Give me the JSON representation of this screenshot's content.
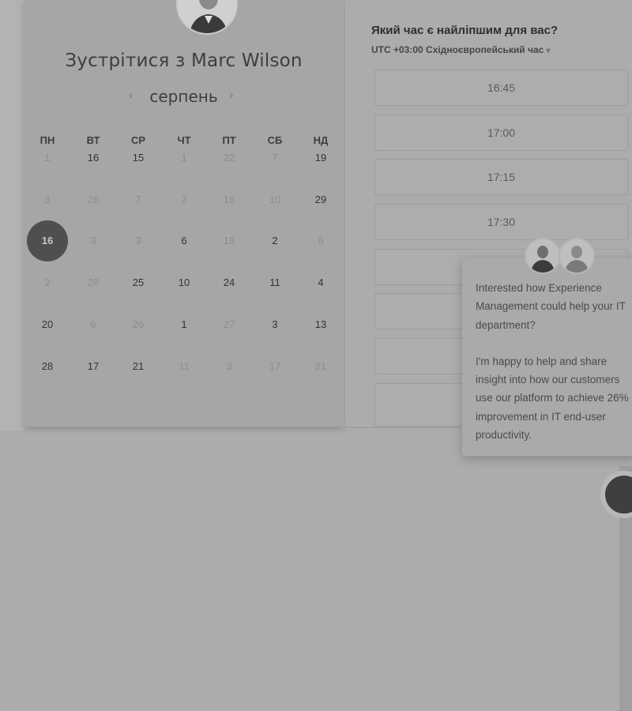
{
  "host": {
    "title": "Зустрітися з Marc Wilson",
    "avatar_icon": "person-photo-icon"
  },
  "calendar": {
    "month": "серпень",
    "prev_icon": "chevron-left-icon",
    "next_icon": "chevron-right-icon",
    "weekdays": [
      "ПН",
      "ВТ",
      "СР",
      "ЧТ",
      "ПТ",
      "СБ",
      "НД"
    ],
    "weeks": [
      [
        {
          "d": "1",
          "a": false
        },
        {
          "d": "16",
          "a": true
        },
        {
          "d": "15",
          "a": true
        },
        {
          "d": "1",
          "a": false
        },
        {
          "d": "22",
          "a": false
        },
        {
          "d": "7",
          "a": false
        },
        {
          "d": "19",
          "a": true
        }
      ],
      [
        {
          "d": "3",
          "a": false
        },
        {
          "d": "26",
          "a": false
        },
        {
          "d": "7",
          "a": false
        },
        {
          "d": "2",
          "a": false
        },
        {
          "d": "16",
          "a": false
        },
        {
          "d": "10",
          "a": false
        },
        {
          "d": "29",
          "a": true
        }
      ],
      [
        {
          "d": "16",
          "a": true,
          "selected": true
        },
        {
          "d": "3",
          "a": false
        },
        {
          "d": "3",
          "a": false
        },
        {
          "d": "6",
          "a": true
        },
        {
          "d": "18",
          "a": false
        },
        {
          "d": "2",
          "a": true
        },
        {
          "d": "6",
          "a": false
        }
      ],
      [
        {
          "d": "2",
          "a": false
        },
        {
          "d": "28",
          "a": false
        },
        {
          "d": "25",
          "a": true
        },
        {
          "d": "10",
          "a": true
        },
        {
          "d": "24",
          "a": true
        },
        {
          "d": "11",
          "a": true
        },
        {
          "d": "4",
          "a": true
        }
      ],
      [
        {
          "d": "20",
          "a": true
        },
        {
          "d": "6",
          "a": false
        },
        {
          "d": "26",
          "a": false
        },
        {
          "d": "1",
          "a": true
        },
        {
          "d": "27",
          "a": false
        },
        {
          "d": "3",
          "a": true
        },
        {
          "d": "13",
          "a": true
        }
      ],
      [
        {
          "d": "28",
          "a": true
        },
        {
          "d": "17",
          "a": true
        },
        {
          "d": "21",
          "a": true
        },
        {
          "d": "11",
          "a": false
        },
        {
          "d": "3",
          "a": false
        },
        {
          "d": "17",
          "a": false
        },
        {
          "d": "21",
          "a": false
        }
      ]
    ]
  },
  "times": {
    "question": "Який час є найліпшим для вас?",
    "timezone": "UTC +03:00 Східноєвропейський час",
    "timezone_caret": "▾",
    "slots": [
      "16:45",
      "17:00",
      "17:15",
      "17:30",
      "",
      "",
      "",
      ""
    ]
  },
  "chat": {
    "paragraph1": "Interested how Experience Management could help your IT department?",
    "paragraph2": "I'm happy to help and share insight into how our customers use our platform to achieve 26% improvement in IT end-user productivity.",
    "agent_icons": [
      "agent-avatar-icon",
      "agent-avatar-icon"
    ],
    "launcher_icon": "chat-bubble-icon"
  },
  "colors": {
    "overlay": "#acacac",
    "selected_day": "#4f4f4f"
  }
}
